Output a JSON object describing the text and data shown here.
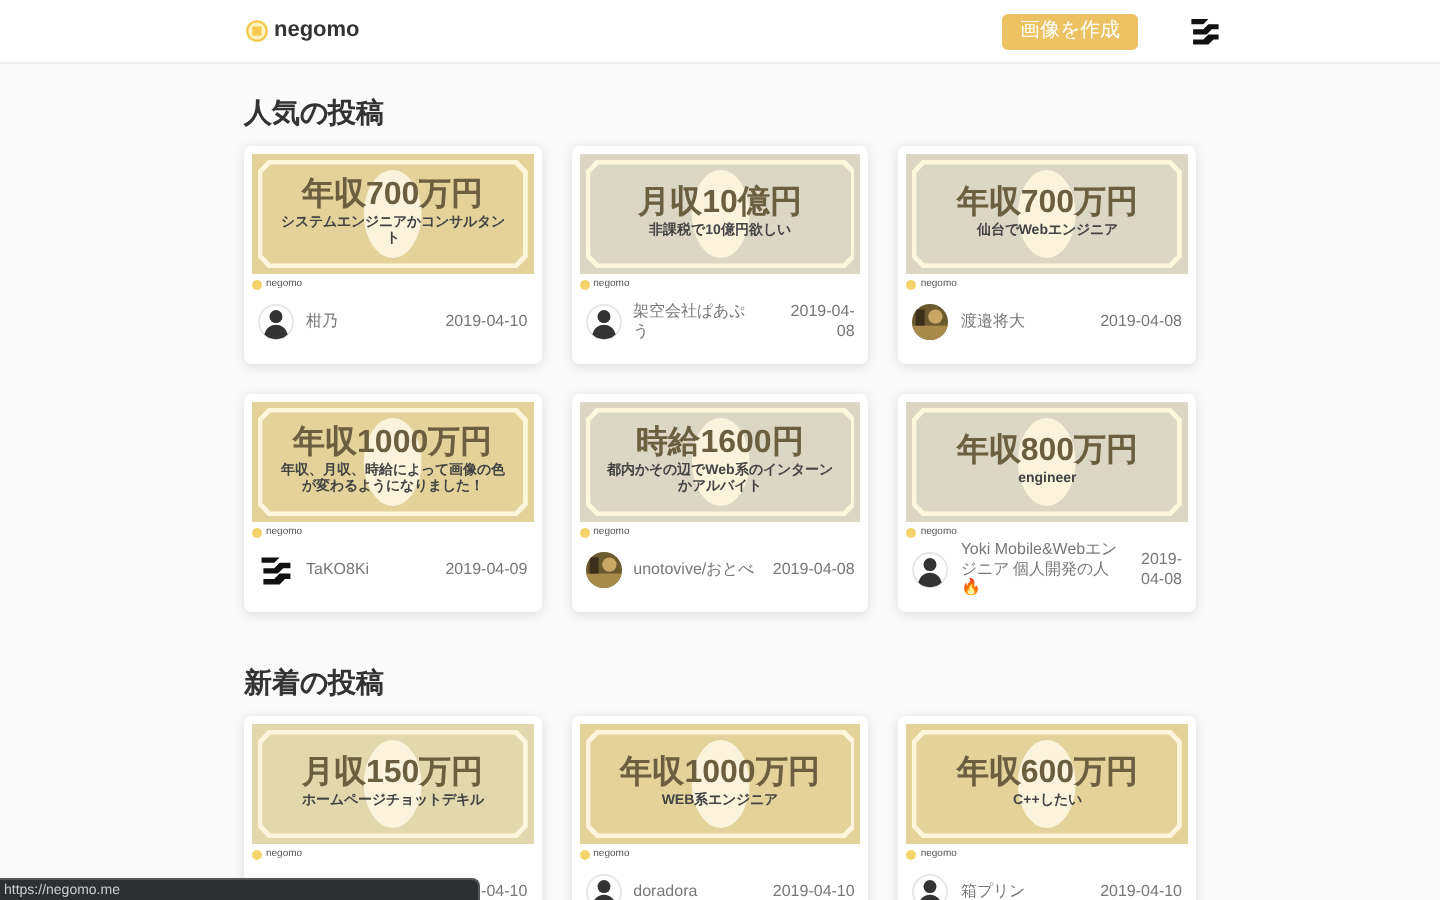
{
  "header": {
    "logo_text": "negomo",
    "create_button": "画像を作成"
  },
  "sections": [
    {
      "title": "人気の投稿",
      "cards": [
        {
          "amount": "年収700万円",
          "subtitle": "システムエンジニアかコンサルタント",
          "color": "#e3d39b",
          "brand": "negomo",
          "avatar": {
            "kind": "default"
          },
          "author": "柑乃",
          "date": "2019-04-10"
        },
        {
          "amount": "月収10億円",
          "subtitle": "非課税で10億円欲しい",
          "color": "#dcd6c5",
          "brand": "negomo",
          "avatar": {
            "kind": "default"
          },
          "author": "架空会社ぱあぷう",
          "date": "2019-04-08"
        },
        {
          "amount": "年収700万円",
          "subtitle": "仙台でWebエンジニア",
          "color": "#dcd6c5",
          "brand": "negomo",
          "author": "渡邉将大",
          "date": "2019-04-08"
        },
        {
          "amount": "年収1000万円",
          "subtitle": "年収、月収、時給によって画像の色が変わるようになりました！",
          "color": "#e3d39b",
          "brand": "negomo",
          "avatar": {
            "kind": "logo"
          },
          "author": "TaKO8Ki",
          "date": "2019-04-09"
        },
        {
          "amount": "時給1600円",
          "subtitle": "都内かその辺でWeb系のインターンかアルバイト",
          "color": "#dcd6c5",
          "brand": "negomo",
          "author": "unotovive/おとべ",
          "date": "2019-04-08"
        },
        {
          "amount": "年収800万円",
          "subtitle": "engineer",
          "color": "#dcd6c5",
          "brand": "negomo",
          "avatar": {
            "kind": "default"
          },
          "author": "Yoki Mobile&Webエンジニア 個人開発の人🔥",
          "date": "2019-04-08"
        }
      ]
    },
    {
      "title": "新着の投稿",
      "cards": [
        {
          "amount": "月収150万円",
          "subtitle": "ホームページチョットデキル",
          "color": "#e3d7ae",
          "brand": "negomo",
          "date": "-04-10"
        },
        {
          "amount": "年収1000万円",
          "subtitle": "WEB系エンジニア",
          "color": "#e3d39b",
          "brand": "negomo",
          "avatar": {
            "kind": "default"
          },
          "author": "doradora",
          "date": "2019-04-10"
        },
        {
          "amount": "年収600万円",
          "subtitle": "C++したい",
          "color": "#e3d39b",
          "brand": "negomo",
          "avatar": {
            "kind": "default"
          },
          "author": "箱プリン",
          "date": "2019-04-10"
        }
      ]
    }
  ],
  "status_bar": {
    "url": "https://negomo.me"
  }
}
